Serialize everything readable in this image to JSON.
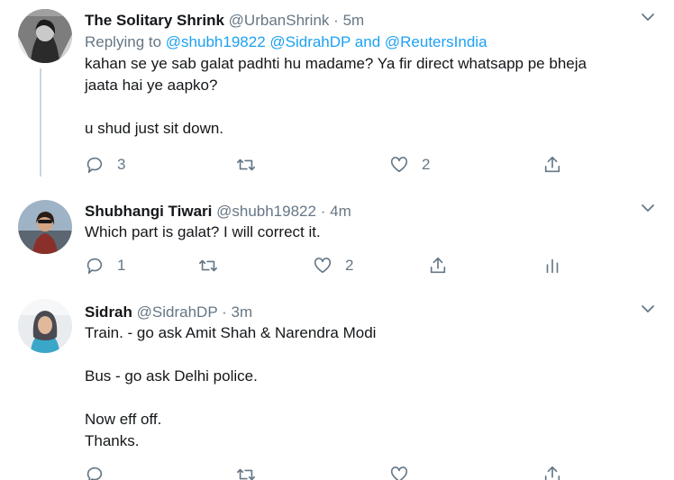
{
  "tweets": [
    {
      "name": "The Solitary Shrink",
      "handle": "@UrbanShrink",
      "sep": "·",
      "time": "5m",
      "reply_prefix": "Replying to",
      "reply_mentions": "@shubh19822 @SidrahDP and @ReutersIndia",
      "lines": [
        "kahan se ye sab galat padhti hu madame? Ya fir direct whatsapp pe bheja",
        "jaata hai ye aapko?",
        "u shud just sit down."
      ],
      "reply_count": "3",
      "retweet_count": "",
      "like_count": "2"
    },
    {
      "name": "Shubhangi Tiwari",
      "handle": "@shubh19822",
      "sep": "·",
      "time": "4m",
      "lines": [
        "Which part is galat? I will correct it."
      ],
      "reply_count": "1",
      "retweet_count": "",
      "like_count": "2"
    },
    {
      "name": "Sidrah",
      "handle": "@SidrahDP",
      "sep": "·",
      "time": "3m",
      "lines": [
        "Train. - go ask Amit Shah & Narendra Modi",
        "Bus - go ask Delhi police.",
        "Now eff off.",
        "Thanks."
      ],
      "reply_count": "",
      "retweet_count": "",
      "like_count": ""
    }
  ],
  "icons": {
    "reply": "reply-icon",
    "retweet": "retweet-icon",
    "like": "heart-icon",
    "share": "share-icon",
    "analytics": "analytics-icon",
    "more": "chevron-down-icon"
  },
  "colors": {
    "text": "#14171a",
    "secondary": "#657786",
    "link": "#1da1f2",
    "thread": "#ccd6dd"
  }
}
